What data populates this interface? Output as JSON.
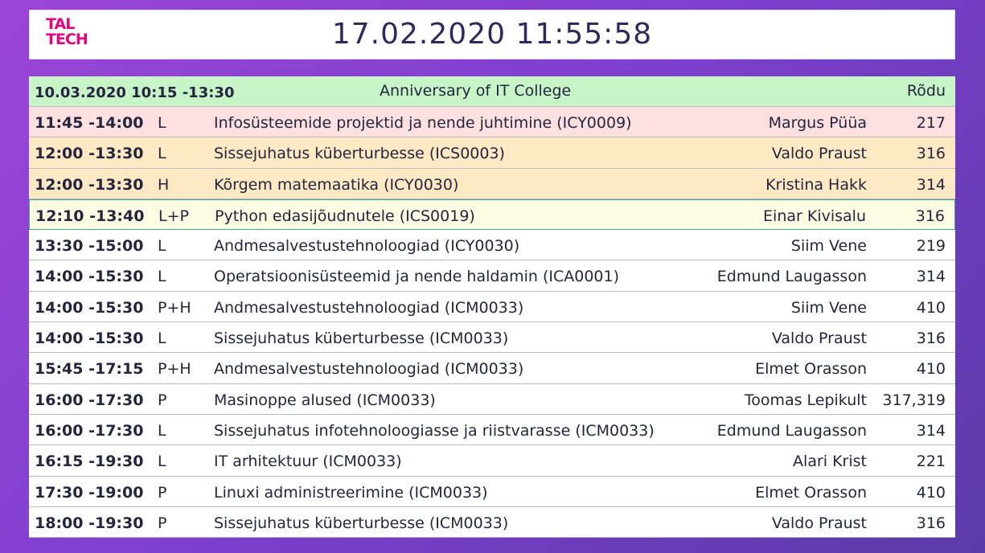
{
  "logo": {
    "line1": "TAL",
    "line2": "TECH"
  },
  "clock": "17.02.2020 11:55:58",
  "header_row": {
    "time": "10.03.2020 10:15 -13:30",
    "event": "Anniversary of IT College",
    "room_label": "Rõdu"
  },
  "rows": [
    {
      "time": "11:45 -14:00",
      "type": "L",
      "title": "Infosüsteemide projektid ja nende juhtimine (ICY0009)",
      "lecturer": "Margus Püüa",
      "room": "217"
    },
    {
      "time": "12:00 -13:30",
      "type": "L",
      "title": "Sissejuhatus küberturbesse (ICS0003)",
      "lecturer": "Valdo Praust",
      "room": "316"
    },
    {
      "time": "12:00 -13:30",
      "type": "H",
      "title": "Kõrgem matemaatika (ICY0030)",
      "lecturer": "Kristina Hakk",
      "room": "314"
    },
    {
      "time": "12:10 -13:40",
      "type": "L+P",
      "title": "Python edasijõudnutele (ICS0019)",
      "lecturer": "Einar Kivisalu",
      "room": "316"
    },
    {
      "time": "13:30 -15:00",
      "type": "L",
      "title": "Andmesalvestustehnoloogiad (ICY0030)",
      "lecturer": "Siim Vene",
      "room": "219"
    },
    {
      "time": "14:00 -15:30",
      "type": "L",
      "title": "Operatsioonisüsteemid ja nende haldamin (ICA0001)",
      "lecturer": "Edmund Laugasson",
      "room": "314"
    },
    {
      "time": "14:00 -15:30",
      "type": "P+H",
      "title": "Andmesalvestustehnoloogiad (ICM0033)",
      "lecturer": "Siim Vene",
      "room": "410"
    },
    {
      "time": "14:00 -15:30",
      "type": "L",
      "title": "Sissejuhatus küberturbesse (ICM0033)",
      "lecturer": "Valdo Praust",
      "room": "316"
    },
    {
      "time": "15:45 -17:15",
      "type": "P+H",
      "title": "Andmesalvestustehnoloogiad (ICM0033)",
      "lecturer": "Elmet Orasson",
      "room": "410"
    },
    {
      "time": "16:00 -17:30",
      "type": "P",
      "title": "Masinoppe alused (ICM0033)",
      "lecturer": "Toomas Lepikult",
      "room": "317,319"
    },
    {
      "time": "16:00 -17:30",
      "type": "L",
      "title": "Sissejuhatus infotehnoloogiasse ja riistvarasse (ICM0033)",
      "lecturer": "Edmund Laugasson",
      "room": "314"
    },
    {
      "time": "16:15 -19:30",
      "type": "L",
      "title": "IT arhitektuur (ICM0033)",
      "lecturer": "Alari Krist",
      "room": "221"
    },
    {
      "time": "17:30 -19:00",
      "type": "P",
      "title": "Linuxi administreerimine (ICM0033)",
      "lecturer": "Elmet Orasson",
      "room": "410"
    },
    {
      "time": "18:00 -19:30",
      "type": "P",
      "title": "Sissejuhatus küberturbesse (ICM0033)",
      "lecturer": "Valdo Praust",
      "room": "316"
    }
  ]
}
